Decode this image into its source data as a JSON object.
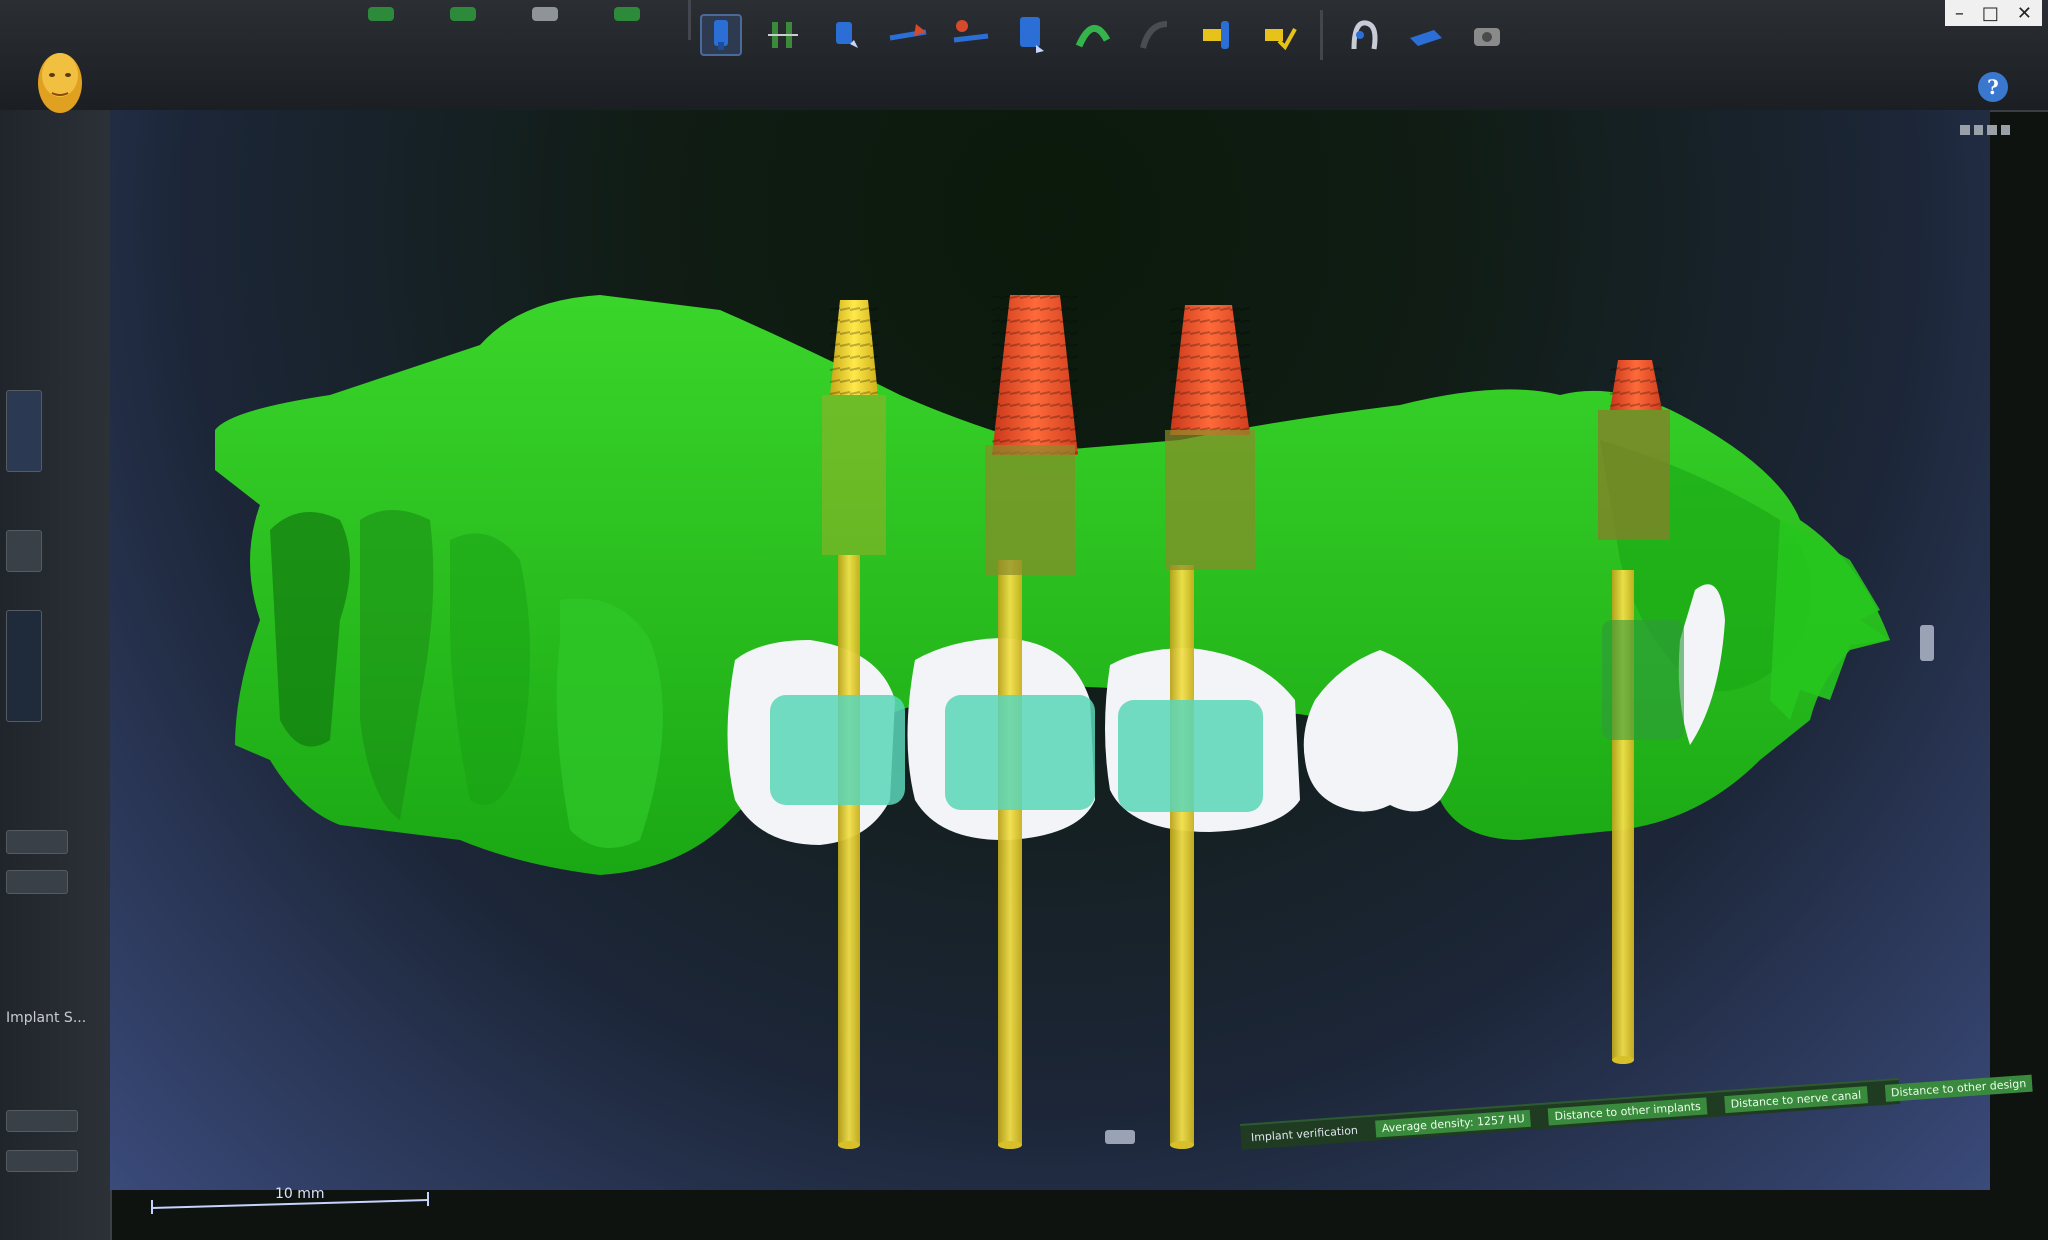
{
  "window": {
    "controls": [
      "–",
      "□",
      "✕"
    ]
  },
  "toolbar": {
    "icons": [
      {
        "name": "tool-a-icon",
        "color": "#2c8a3a"
      },
      {
        "name": "tool-b-icon",
        "color": "#2c8a3a"
      },
      {
        "name": "tool-c-icon",
        "color": "#9a9a9a"
      },
      {
        "name": "tool-d-icon",
        "color": "#2c8a3a"
      },
      {
        "name": "implant-position-icon",
        "color": "#2b6fd6",
        "active": true
      },
      {
        "name": "implant-parallel-icon",
        "color": "#3a8a3a"
      },
      {
        "name": "implant-rotate-icon",
        "color": "#2b6fd6"
      },
      {
        "name": "implant-move-icon",
        "color": "#2b6fd6"
      },
      {
        "name": "implant-measure-icon",
        "color": "#d64a2b"
      },
      {
        "name": "implant-cube-icon",
        "color": "#2b6fd6"
      },
      {
        "name": "arc-green-icon",
        "color": "#34b44a"
      },
      {
        "name": "arc-grey-icon",
        "color": "#5a5a5a"
      },
      {
        "name": "sleeve-yellow-icon",
        "color": "#e6c21a"
      },
      {
        "name": "sleeve-checked-icon",
        "color": "#e6c21a"
      },
      {
        "name": "nerve-icon",
        "color": "#c8ccd6"
      },
      {
        "name": "scan-blue-icon",
        "color": "#2b6fd6"
      },
      {
        "name": "camera-icon",
        "color": "#8a8a8a"
      }
    ],
    "help_label": "?"
  },
  "status_bar": {
    "items": [
      "Implant verification",
      "Average density: 1257 HU",
      "Distance to other implants",
      "Distance to nerve canal",
      "Distance to other design"
    ]
  },
  "scale": {
    "label": "10 mm"
  },
  "left_panel": {
    "labels": [
      "Implant S..."
    ]
  },
  "colors": {
    "model": "#22c41a",
    "implant_thread_red": "#f04a2a",
    "implant_thread_yellow": "#f2d21a",
    "drill_pin": "#e8d23a",
    "sleeve": "#5ad6b8",
    "crown": "#f2f4f7"
  }
}
